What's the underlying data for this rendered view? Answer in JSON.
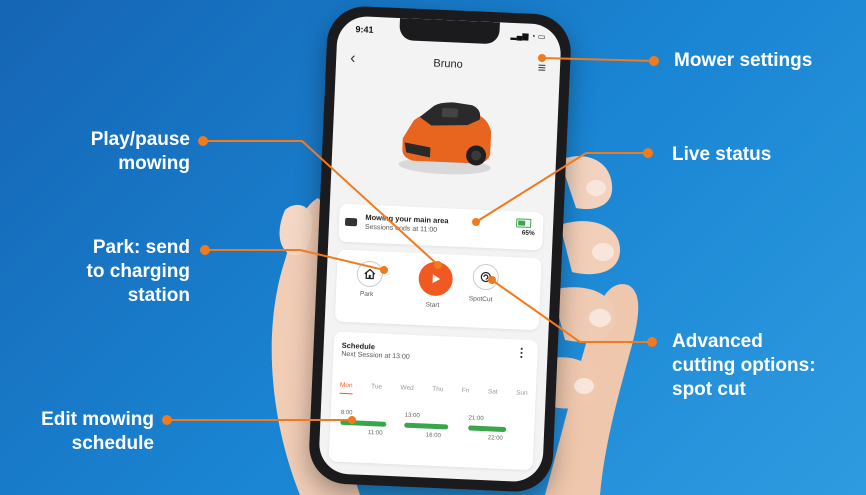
{
  "callouts": {
    "mower_settings": "Mower settings",
    "play_pause": [
      "Play/pause",
      "mowing"
    ],
    "live_status": "Live status",
    "park": [
      "Park: send",
      "to charging",
      "station"
    ],
    "advanced": [
      "Advanced",
      "cutting options:",
      "spot cut"
    ],
    "edit_schedule": [
      "Edit mowing",
      "schedule"
    ]
  },
  "phone": {
    "status_time": "9:41",
    "nav": {
      "title": "Bruno",
      "back_icon": "chevron-left-icon",
      "menu_icon": "hamburger-menu-icon"
    },
    "status_card": {
      "line1": "Mowing your main area",
      "line2": "Sessions ends at 11:00",
      "battery": "65%"
    },
    "controls": {
      "park_label": "Park",
      "start_label": "Start",
      "spotcut_label": "SpotCut"
    },
    "schedule": {
      "title": "Schedule",
      "next_session": "Next Session at 13:00",
      "days": [
        "Mon",
        "Tue",
        "Wed",
        "Thu",
        "Fri",
        "Sat",
        "Sun"
      ],
      "active_day": "Mon",
      "slots": [
        {
          "start": "8:00",
          "end": "11:00"
        },
        {
          "start": "13:00",
          "end": "16:00"
        },
        {
          "start": "21:00",
          "end": "22:00"
        }
      ]
    }
  },
  "colors": {
    "accent_orange": "#f05a22",
    "callout_dot": "#f07a1e",
    "green": "#3aa64b",
    "background_blue": "#1a86d4"
  }
}
